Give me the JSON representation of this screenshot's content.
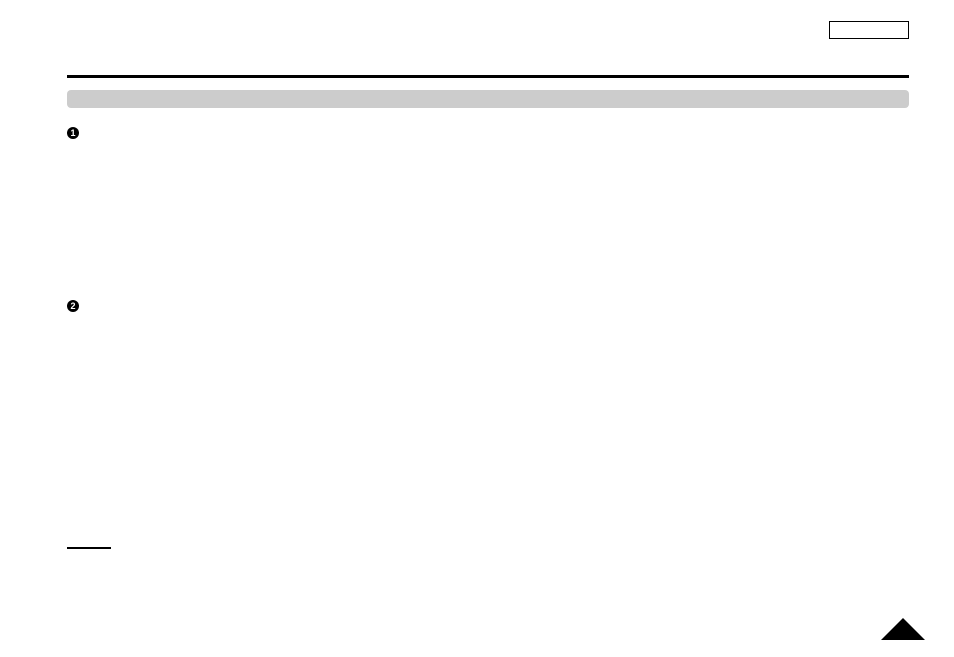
{
  "bullets": {
    "one": "1",
    "two": "2"
  }
}
